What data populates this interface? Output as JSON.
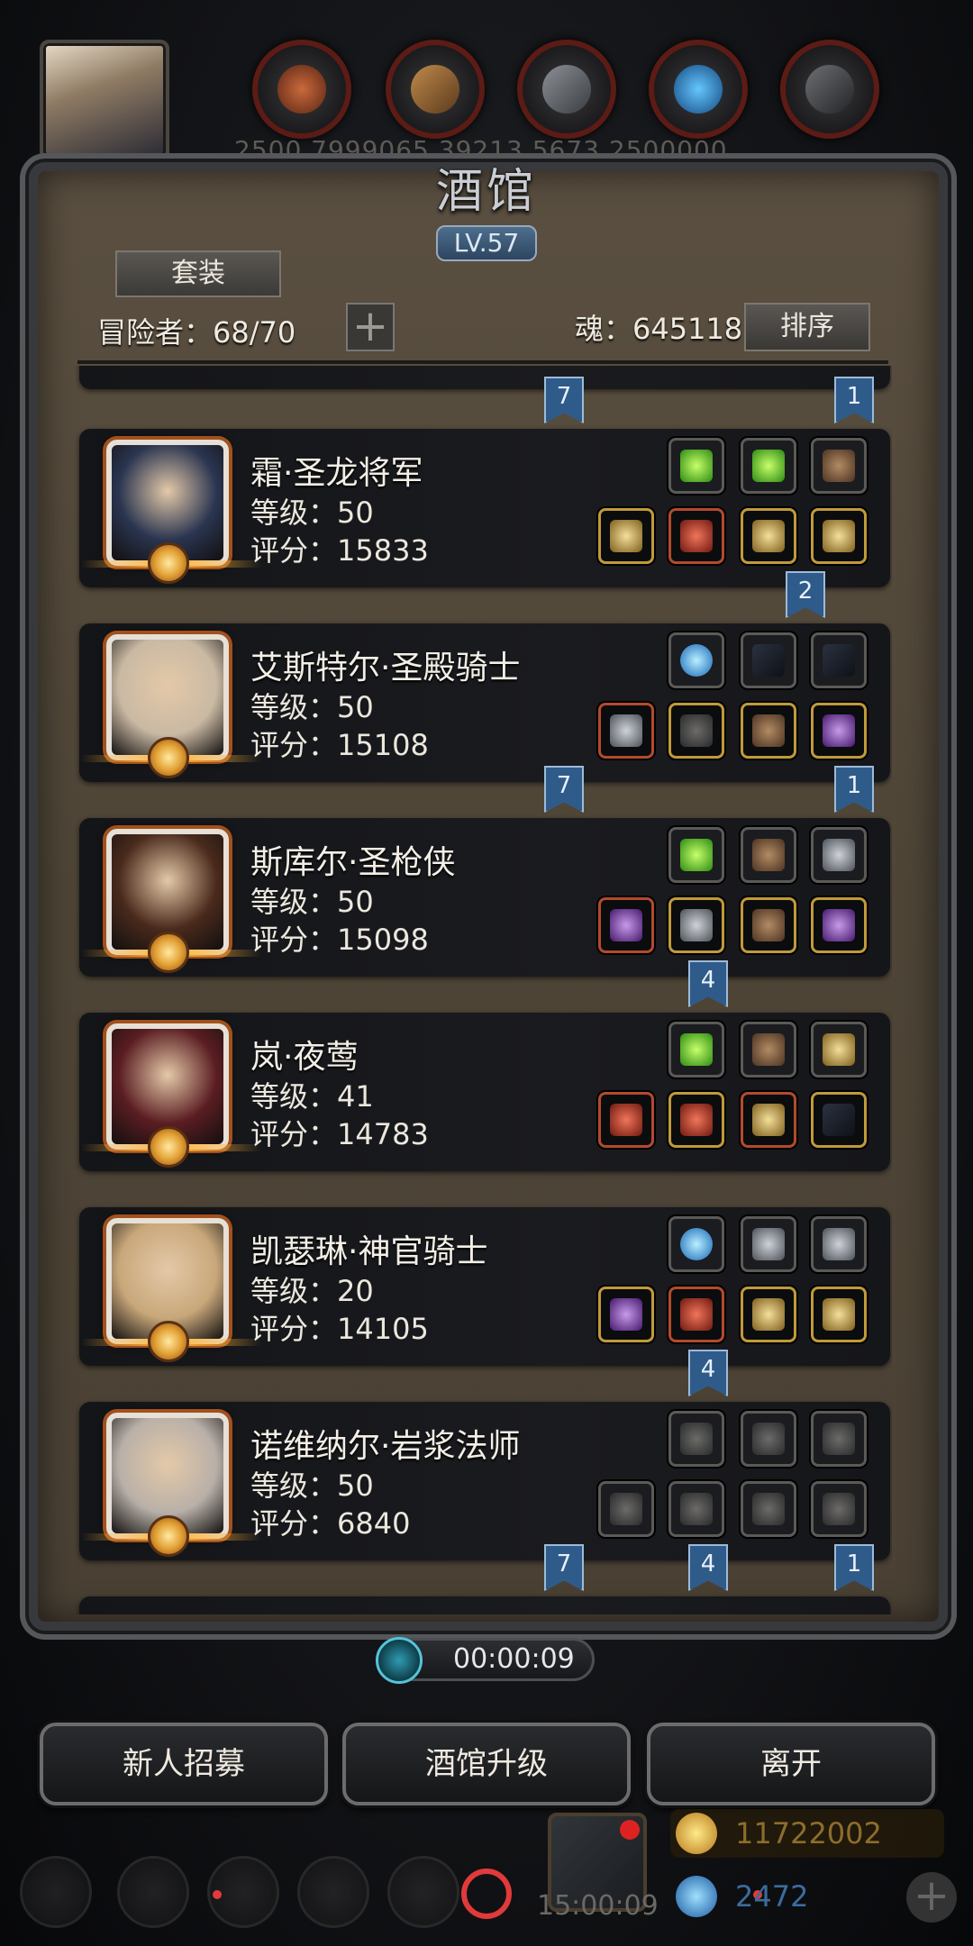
{
  "top_bar": {
    "resource_values": "2500   7999065  39213   5673  2500000"
  },
  "panel": {
    "title": "酒馆",
    "level": "LV.57",
    "suit_button": "套装",
    "adventurers_label": "冒险者：68/70",
    "add_button": "+",
    "soul_label": "魂：645118",
    "sort_button": "排序"
  },
  "heroes": [
    {
      "name": "霜·圣龙将军",
      "level": "等级：50",
      "score": "评分：15833",
      "flags": [
        {
          "value": "7",
          "pos": "left"
        },
        {
          "value": "1",
          "pos": "right"
        }
      ],
      "slots_top": [
        "green",
        "green",
        "brown"
      ],
      "slots_bottom": [
        "gold",
        "red",
        "gold",
        "gold"
      ],
      "slot_colors_top": [
        "grey",
        "grey",
        "grey"
      ],
      "slot_colors_bottom": [
        "gold",
        "red",
        "gold",
        "gold"
      ],
      "portrait_color": "#2a3550"
    },
    {
      "name": "艾斯特尔·圣殿骑士",
      "level": "等级：50",
      "score": "评分：15108",
      "flags": [
        {
          "value": "2",
          "pos": "mid"
        }
      ],
      "slots_top": [
        "blue",
        "dark",
        "dark"
      ],
      "slots_bottom": [
        "metal",
        "ghost",
        "brown",
        "purple"
      ],
      "slot_colors_top": [
        "grey",
        "grey",
        "grey"
      ],
      "slot_colors_bottom": [
        "red",
        "gold",
        "gold",
        "gold"
      ],
      "portrait_color": "#c9b9a3"
    },
    {
      "name": "斯库尔·圣枪侠",
      "level": "等级：50",
      "score": "评分：15098",
      "flags": [
        {
          "value": "7",
          "pos": "left"
        },
        {
          "value": "1",
          "pos": "right"
        }
      ],
      "slots_top": [
        "green",
        "brown",
        "metal"
      ],
      "slots_bottom": [
        "purple",
        "metal",
        "brown",
        "purple"
      ],
      "slot_colors_top": [
        "grey",
        "grey",
        "grey"
      ],
      "slot_colors_bottom": [
        "red",
        "gold",
        "gold",
        "gold"
      ],
      "portrait_color": "#4a2a1c"
    },
    {
      "name": "岚·夜莺",
      "level": "等级：41",
      "score": "评分：14783",
      "flags": [
        {
          "value": "4",
          "pos": "center"
        }
      ],
      "slots_top": [
        "green",
        "brown",
        "gold"
      ],
      "slots_bottom": [
        "red",
        "red",
        "gold",
        "dark"
      ],
      "slot_colors_top": [
        "grey",
        "grey",
        "grey"
      ],
      "slot_colors_bottom": [
        "red",
        "gold",
        "red",
        "gold"
      ],
      "portrait_color": "#5a1d22"
    },
    {
      "name": "凯瑟琳·神官骑士",
      "level": "等级：20",
      "score": "评分：14105",
      "flags": [],
      "slots_top": [
        "blue",
        "metal",
        "metal"
      ],
      "slots_bottom": [
        "purple",
        "red",
        "gold",
        "gold"
      ],
      "slot_colors_top": [
        "grey",
        "grey",
        "grey"
      ],
      "slot_colors_bottom": [
        "gold",
        "red",
        "gold",
        "gold"
      ],
      "portrait_color": "#c8a77a"
    },
    {
      "name": "诺维纳尔·岩浆法师",
      "level": "等级：50",
      "score": "评分：6840",
      "flags": [
        {
          "value": "4",
          "pos": "center"
        }
      ],
      "slots_top": [
        "ghost",
        "ghost",
        "ghost"
      ],
      "slots_bottom": [
        "ghost",
        "ghost",
        "ghost",
        "ghost"
      ],
      "slot_colors_top": [
        "grey",
        "grey",
        "grey"
      ],
      "slot_colors_bottom": [
        "grey",
        "grey",
        "grey",
        "grey"
      ],
      "portrait_color": "#b8b0a8"
    }
  ],
  "bottom_flags": [
    {
      "value": "7"
    },
    {
      "value": "4"
    },
    {
      "value": "1"
    }
  ],
  "timer": "00:00:09",
  "buttons": {
    "recruit": "新人招募",
    "upgrade": "酒馆升级",
    "leave": "离开"
  },
  "dock": {
    "gold": "11722002",
    "gems": "2472",
    "time": "15:00:09"
  },
  "colors": {
    "accent_blue": "#2f5b8a",
    "panel_brown": "#4e4537",
    "alert_red": "#e03a3a"
  }
}
